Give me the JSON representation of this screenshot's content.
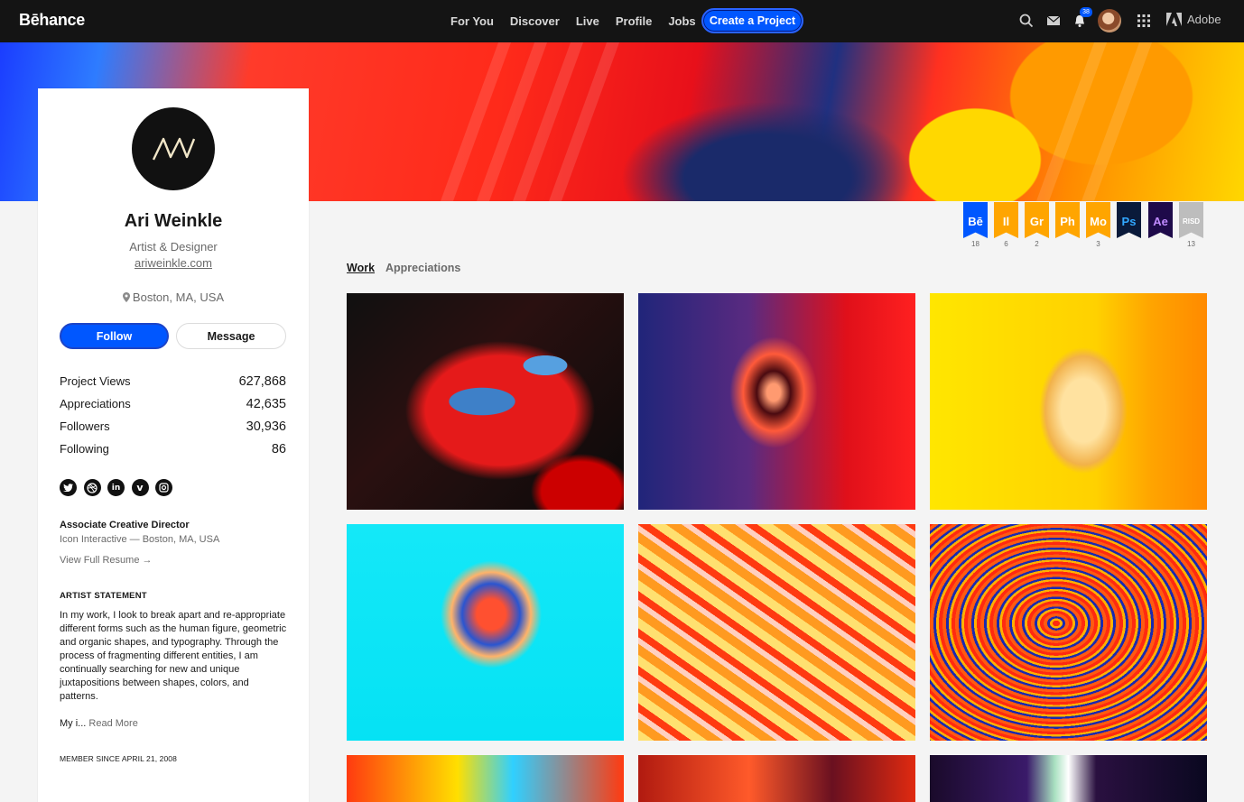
{
  "nav": {
    "logo": "Bēhance",
    "links": [
      "For You",
      "Discover",
      "Live",
      "Profile",
      "Jobs"
    ],
    "create_button": "Create a Project",
    "notification_count": "38",
    "adobe_label": "Adobe"
  },
  "profile": {
    "name": "Ari Weinkle",
    "occupation": "Artist & Designer",
    "website": "ariweinkle.com",
    "location": "Boston, MA, USA",
    "follow_label": "Follow",
    "message_label": "Message",
    "stats": [
      {
        "label": "Project Views",
        "value": "627,868"
      },
      {
        "label": "Appreciations",
        "value": "42,635"
      },
      {
        "label": "Followers",
        "value": "30,936"
      },
      {
        "label": "Following",
        "value": "86"
      }
    ],
    "socials": [
      "twitter-icon",
      "dribbble-icon",
      "linkedin-icon",
      "vimeo-icon",
      "instagram-icon"
    ],
    "job_title": "Associate Creative Director",
    "job_company": "Icon Interactive — Boston, MA, USA",
    "resume_link": "View Full Resume",
    "statement_heading": "ARTIST STATEMENT",
    "statement": "In my work, I look to break apart and re-appropriate different forms such as the human figure, geometric and organic shapes, and typography. Through the process of fragmenting different entities, I am continually searching for new and unique juxtapositions between shapes, colors, and patterns.",
    "statement_more_prefix": "My i...",
    "read_more": "Read More",
    "member_since": "MEMBER SINCE APRIL 21, 2008"
  },
  "ribbons": [
    {
      "label": "Bē",
      "count": "18",
      "color": "#0057ff"
    },
    {
      "label": "Il",
      "count": "6",
      "color": "#ffa500"
    },
    {
      "label": "Gr",
      "count": "2",
      "color": "#ffa500"
    },
    {
      "label": "Ph",
      "count": "",
      "color": "#ffa500"
    },
    {
      "label": "Mo",
      "count": "3",
      "color": "#ffa500"
    },
    {
      "label": "Ps",
      "count": "",
      "color": "#0a1a3a"
    },
    {
      "label": "Ae",
      "count": "",
      "color": "#1e0a4a"
    },
    {
      "label": "RISD",
      "count": "13",
      "color": "#bdbdbd"
    }
  ],
  "tabs": {
    "work": "Work",
    "appreciations": "Appreciations"
  },
  "colors": {
    "accent": "#0057ff",
    "topbar": "#141414"
  }
}
